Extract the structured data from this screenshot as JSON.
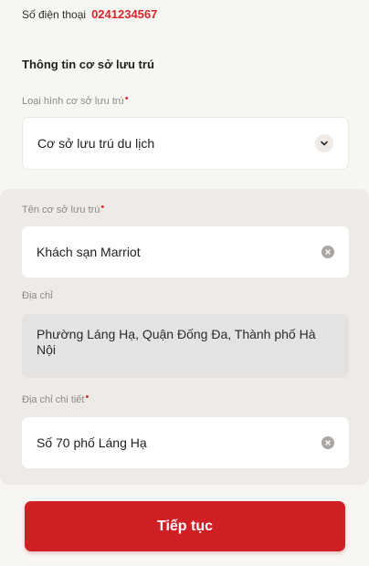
{
  "contact": {
    "phone_label": "Số điện thoại",
    "phone_value": "0241234567"
  },
  "section": {
    "title": "Thông tin cơ sở lưu trú"
  },
  "fields": {
    "accommodation_type": {
      "label": "Loại hình cơ sở lưu trú",
      "required_mark": "•",
      "value": "Cơ sở lưu trú du lịch",
      "icon": "chevron-down-icon"
    },
    "accommodation_name": {
      "label": "Tên cơ sở lưu trú",
      "required_mark": "•",
      "value": "Khách sạn Marriot",
      "icon": "clear-icon"
    },
    "address": {
      "label": "Địa chỉ",
      "value": "Phường Láng Hạ, Quận Đống Đa, Thành phố Hà Nội"
    },
    "address_detail": {
      "label": "Địa chỉ chi tiết",
      "required_mark": "•",
      "value": "Số 70 phố Láng Hạ",
      "icon": "clear-icon"
    }
  },
  "actions": {
    "continue_label": "Tiếp tục"
  },
  "colors": {
    "accent": "#d11f26",
    "phone_text": "#d7262c",
    "panel_bg": "#eeeae5",
    "page_bg": "#f8f6f3"
  }
}
